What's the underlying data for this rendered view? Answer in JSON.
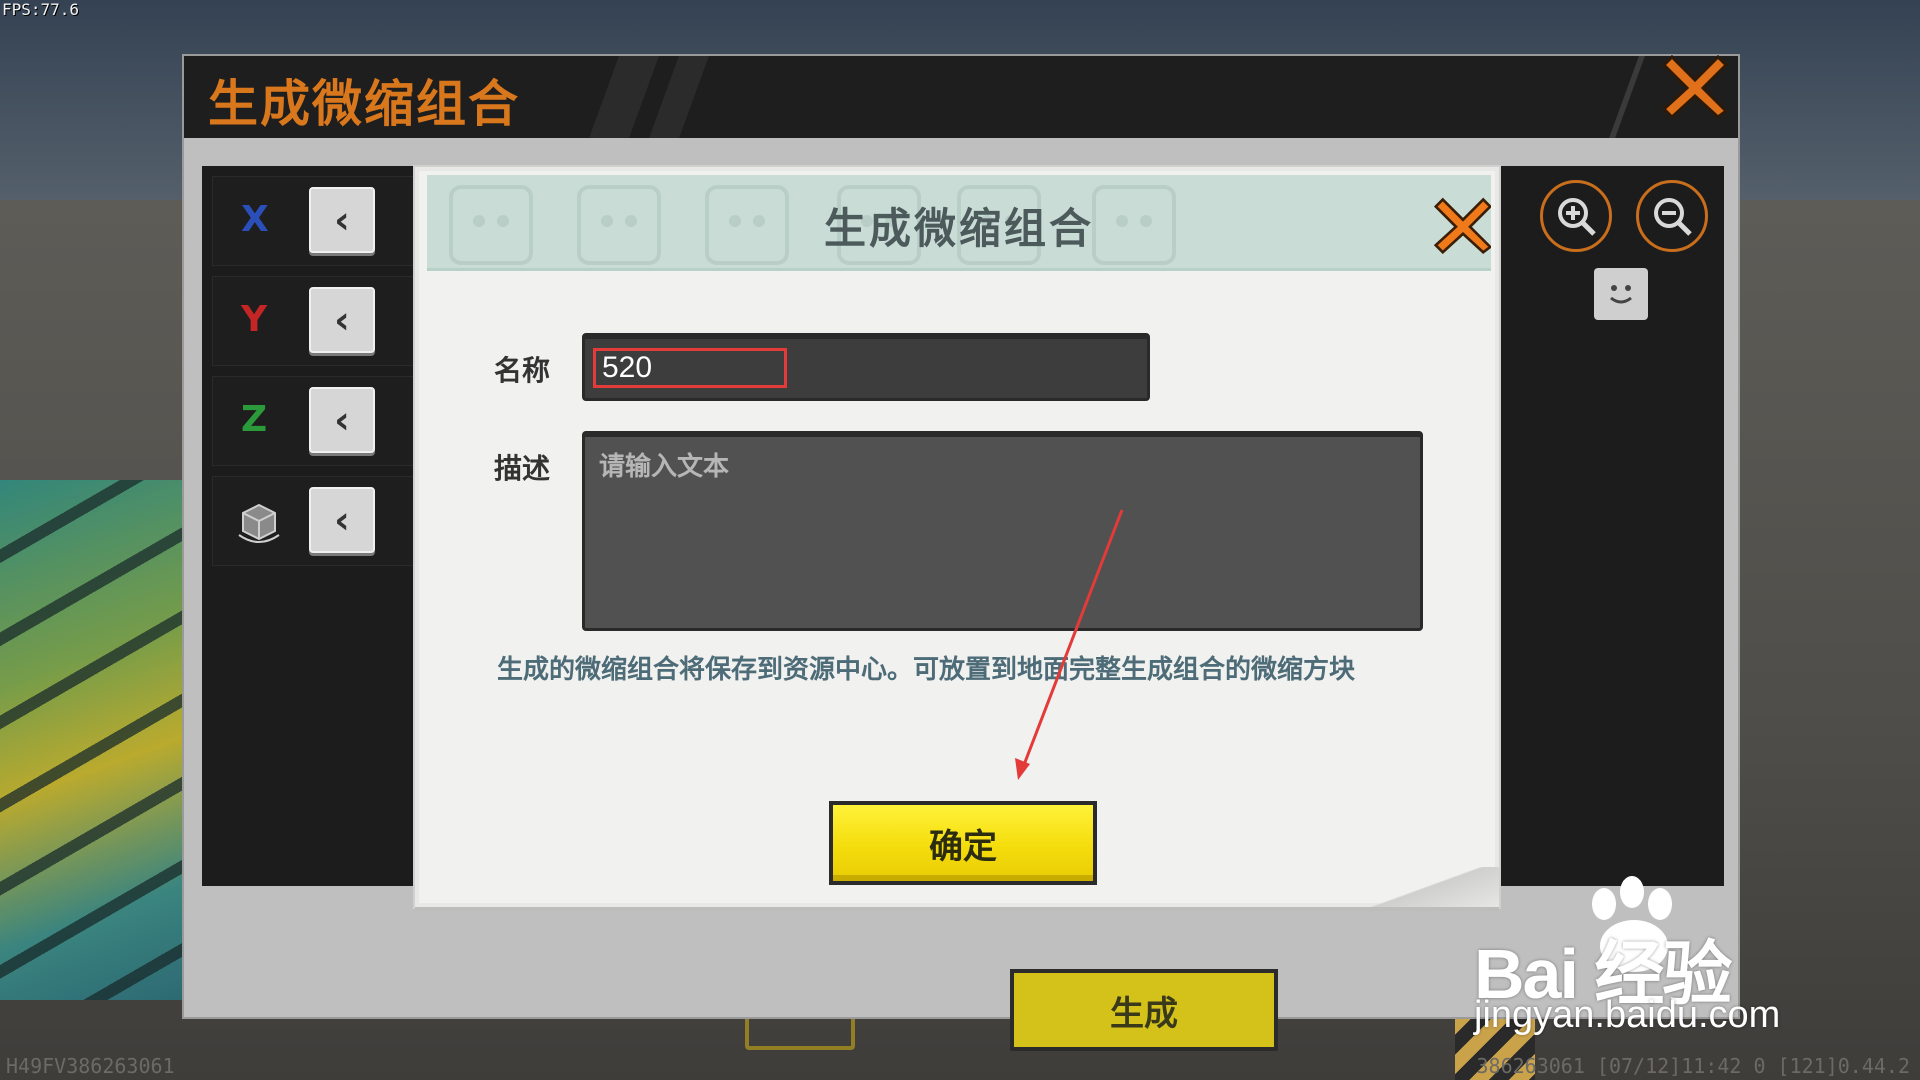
{
  "hud": {
    "fps": "FPS:77.6",
    "footer_left": "H49FV386263061",
    "footer_right": "386263061   [07/12]11:42 0   [121]0.44.2"
  },
  "back_panel": {
    "title": "生成微缩组合",
    "close_icon": "close-x-icon",
    "axes": [
      {
        "label": "X",
        "color": "#2b4fb8",
        "arrow": "‹"
      },
      {
        "label": "Y",
        "color": "#c42525",
        "arrow": "‹"
      },
      {
        "label": "Z",
        "color": "#2b9a3a",
        "arrow": "‹"
      },
      {
        "label": "",
        "icon": "rotate-cube-icon",
        "arrow": "‹"
      }
    ],
    "zoom_in_icon": "zoom-in-icon",
    "zoom_out_icon": "zoom-out-icon",
    "generate_button": "生成"
  },
  "dialog": {
    "title": "生成微缩组合",
    "name_label": "名称",
    "name_value": "520",
    "desc_label": "描述",
    "desc_placeholder": "请输入文本",
    "hint": "生成的微缩组合将保存到资源中心。可放置到地面完整生成组合的微缩方块",
    "ok_button": "确定"
  },
  "watermark": {
    "brand": "Bai  经验",
    "url": "jingyan.baidu.com"
  },
  "colors": {
    "accent_orange": "#e0701a",
    "button_yellow": "#f4dd0c",
    "annotation_red": "#e33a3a"
  }
}
